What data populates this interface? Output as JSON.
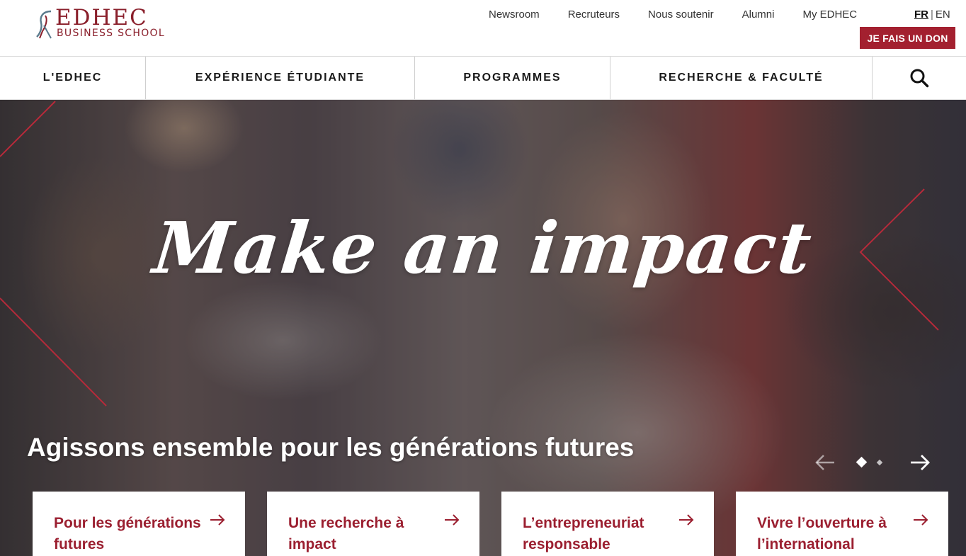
{
  "logo": {
    "name": "EDHEC",
    "subtitle": "BUSINESS SCHOOL"
  },
  "utility_nav": {
    "links": [
      "Newsroom",
      "Recruteurs",
      "Nous soutenir",
      "Alumni",
      "My EDHEC"
    ],
    "lang_fr": "FR",
    "lang_sep": "|",
    "lang_en": "EN",
    "donate_label": "JE FAIS UN DON"
  },
  "main_nav": {
    "items": [
      "L'EDHEC",
      "EXPÉRIENCE ÉTUDIANTE",
      "PROGRAMMES",
      "RECHERCHE & FACULTÉ"
    ],
    "search_icon": "search-icon"
  },
  "hero": {
    "title": "Make an impact",
    "subtitle": "Agissons ensemble pour les générations futures",
    "slide_count": 2,
    "active_slide": 1
  },
  "cards": [
    {
      "title": "Pour les générations futures"
    },
    {
      "title": "Une recherche à impact"
    },
    {
      "title": "L’entrepreneuriat responsable"
    },
    {
      "title": "Vivre l’ouverture à l’international"
    }
  ],
  "colors": {
    "brand": "#a3202f",
    "card_title": "#9b1f30",
    "white": "#ffffff"
  }
}
